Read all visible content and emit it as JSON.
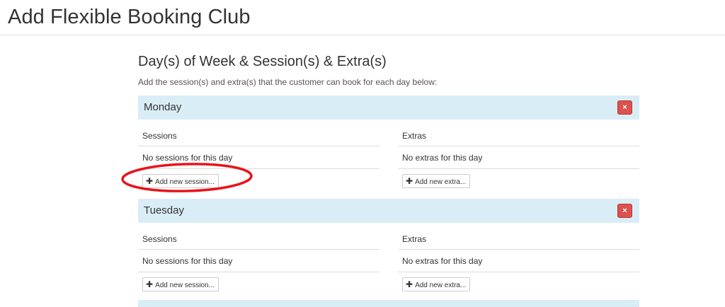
{
  "page": {
    "title": "Add Flexible Booking Club"
  },
  "section": {
    "title": "Day(s) of Week & Session(s) & Extra(s)",
    "description": "Add the session(s) and extra(s) that the customer can book for each day below:"
  },
  "days": [
    {
      "name": "Monday",
      "remove_icon": "×",
      "sessions_heading": "Sessions",
      "sessions_empty": "No sessions for this day",
      "add_session_label": "Add new session...",
      "extras_heading": "Extras",
      "extras_empty": "No extras for this day",
      "add_extra_label": "Add new extra..."
    },
    {
      "name": "Tuesday",
      "remove_icon": "×",
      "sessions_heading": "Sessions",
      "sessions_empty": "No sessions for this day",
      "add_session_label": "Add new session...",
      "extras_heading": "Extras",
      "extras_empty": "No extras for this day",
      "add_extra_label": "Add new extra..."
    }
  ],
  "icons": {
    "plus": "✚",
    "remove": "remove-icon"
  },
  "colors": {
    "day_header_bg": "#d9edf7",
    "remove_button": "#d9534f",
    "annotation_circle": "#e8141c"
  }
}
